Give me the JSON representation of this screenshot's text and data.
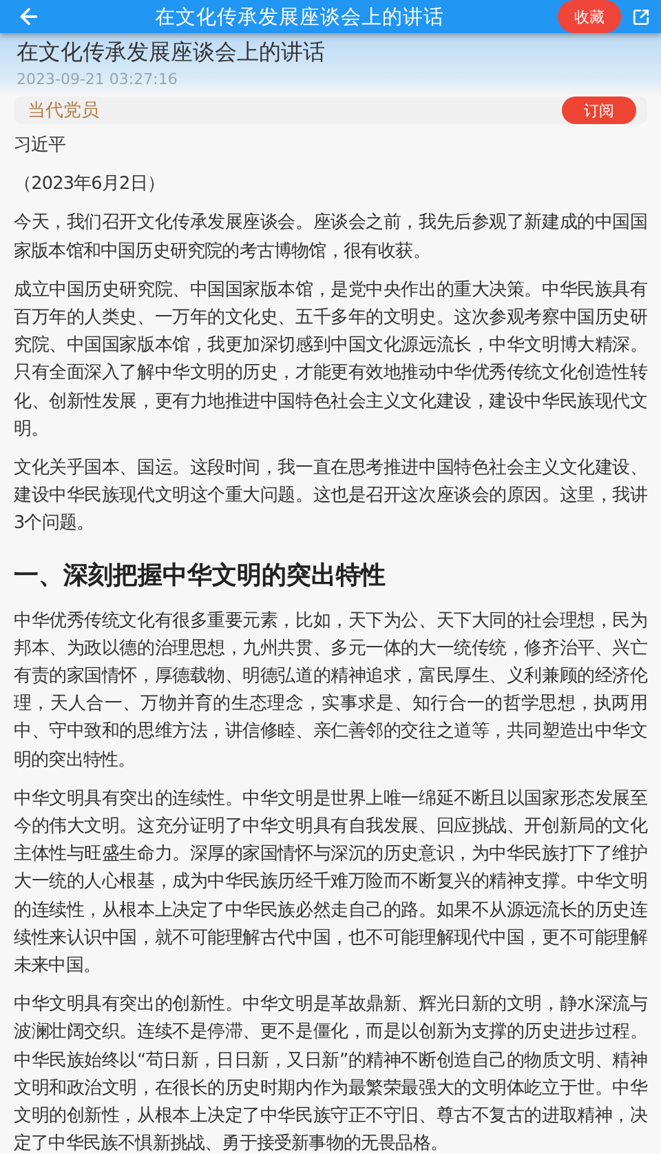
{
  "app_bar": {
    "title": "在文化传承发展座谈会上的讲话",
    "favorite_button": "收藏"
  },
  "article": {
    "title": "在文化传承发展座谈会上的讲话",
    "published": "2023-09-21 03:27:16"
  },
  "channel": {
    "name": "当代党员",
    "subscribe_button": "订阅"
  },
  "body": [
    {
      "kind": "paragraph",
      "text": "习近平"
    },
    {
      "kind": "paragraph",
      "text": "（2023年6月2日）"
    },
    {
      "kind": "paragraph",
      "text": "今天，我们召开文化传承发展座谈会。座谈会之前，我先后参观了新建成的中国国家版本馆和中国历史研究院的考古博物馆，很有收获。"
    },
    {
      "kind": "paragraph",
      "text": "成立中国历史研究院、中国国家版本馆，是党中央作出的重大决策。中华民族具有百万年的人类史、一万年的文化史、五千多年的文明史。这次参观考察中国历史研究院、中国国家版本馆，我更加深切感到中国文化源远流长，中华文明博大精深。只有全面深入了解中华文明的历史，才能更有效地推动中华优秀传统文化创造性转化、创新性发展，更有力地推进中国特色社会主义文化建设，建设中华民族现代文明。"
    },
    {
      "kind": "paragraph",
      "text": "文化关乎国本、国运。这段时间，我一直在思考推进中国特色社会主义文化建设、建设中华民族现代文明这个重大问题。这也是召开这次座谈会的原因。这里，我讲3个问题。"
    },
    {
      "kind": "heading",
      "text": "一、深刻把握中华文明的突出特性"
    },
    {
      "kind": "paragraph",
      "text": "中华优秀传统文化有很多重要元素，比如，天下为公、天下大同的社会理想，民为邦本、为政以德的治理思想，九州共贯、多元一体的大一统传统，修齐治平、兴亡有责的家国情怀，厚德载物、明德弘道的精神追求，富民厚生、义利兼顾的经济伦理，天人合一、万物并育的生态理念，实事求是、知行合一的哲学思想，执两用中、守中致和的思维方法，讲信修睦、亲仁善邻的交往之道等，共同塑造出中华文明的突出特性。"
    },
    {
      "kind": "paragraph",
      "text": "中华文明具有突出的连续性。中华文明是世界上唯一绵延不断且以国家形态发展至今的伟大文明。这充分证明了中华文明具有自我发展、回应挑战、开创新局的文化主体性与旺盛生命力。深厚的家国情怀与深沉的历史意识，为中华民族打下了维护大一统的人心根基，成为中华民族历经千难万险而不断复兴的精神支撑。中华文明的连续性，从根本上决定了中华民族必然走自己的路。如果不从源远流长的历史连续性来认识中国，就不可能理解古代中国，也不可能理解现代中国，更不可能理解未来中国。"
    },
    {
      "kind": "paragraph",
      "text": "中华文明具有突出的创新性。中华文明是革故鼎新、辉光日新的文明，静水深流与波澜壮阔交织。连续不是停滞、更不是僵化，而是以创新为支撑的历史进步过程。中华民族始终以“苟日新，日日新，又日新”的精神不断创造自己的物质文明、精神文明和政治文明，在很长的历史时期内作为最繁荣最强大的文明体屹立于世。中华文明的创新性，从根本上决定了中华民族守正不守旧、尊古不复古的进取精神，决定了中华民族不惧新挑战、勇于接受新事物的无畏品格。"
    }
  ]
}
